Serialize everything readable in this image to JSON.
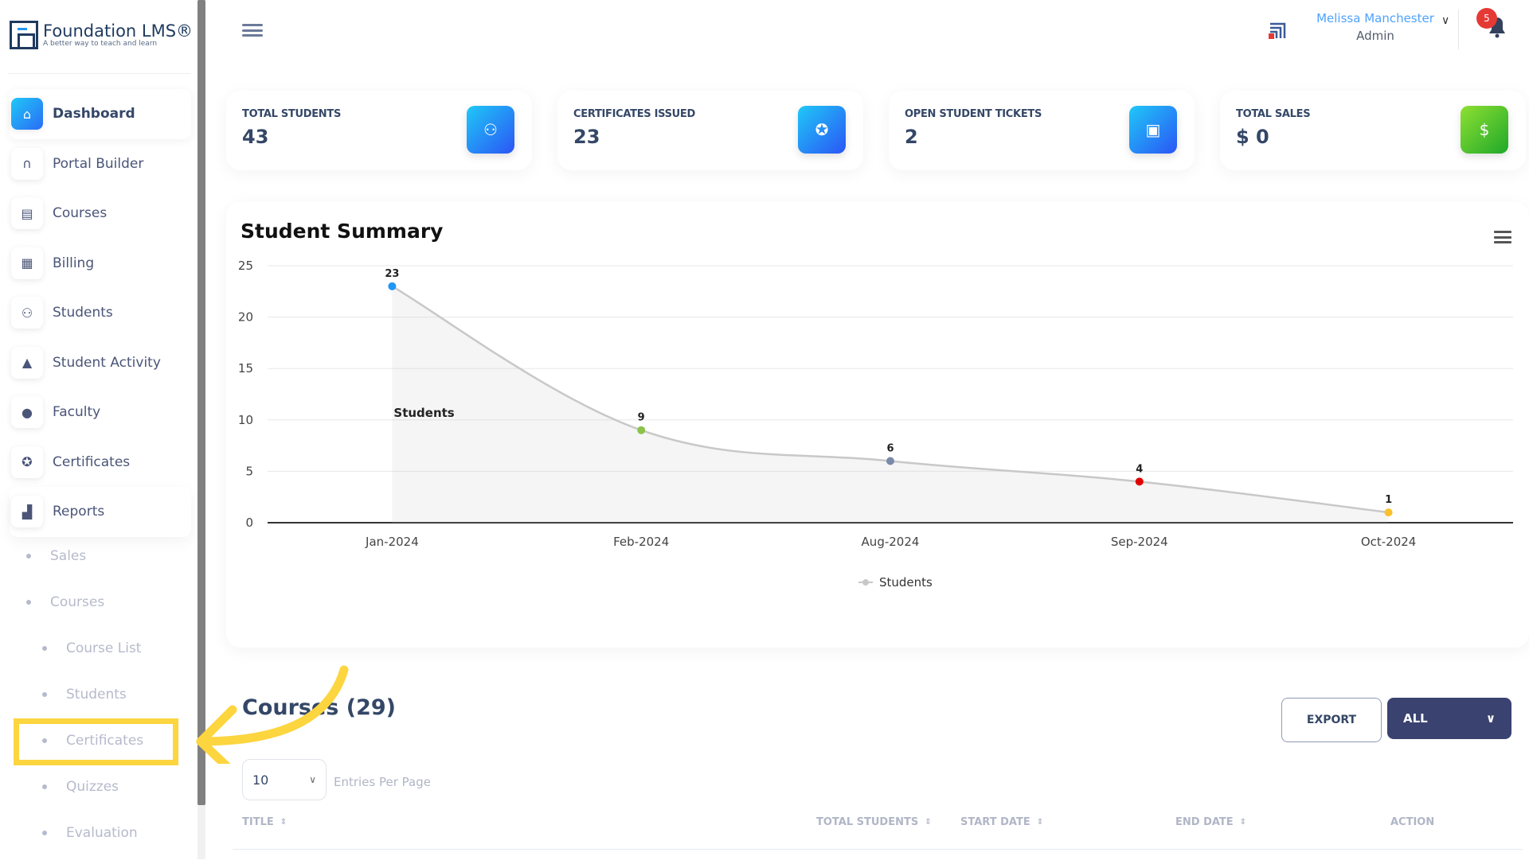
{
  "app": {
    "logo_title": "Foundation LMS®",
    "logo_subtitle": "A better way to teach and learn"
  },
  "sidebar": {
    "items": [
      {
        "label": "Dashboard",
        "icon": "home-icon",
        "active": true
      },
      {
        "label": "Portal Builder",
        "icon": "archway-icon"
      },
      {
        "label": "Courses",
        "icon": "book-icon"
      },
      {
        "label": "Billing",
        "icon": "document-icon"
      },
      {
        "label": "Students",
        "icon": "users-icon"
      },
      {
        "label": "Student Activity",
        "icon": "graduation-cap-icon"
      },
      {
        "label": "Faculty",
        "icon": "user-tie-icon"
      },
      {
        "label": "Certificates",
        "icon": "award-icon"
      },
      {
        "label": "Reports",
        "icon": "area-chart-icon"
      }
    ],
    "report_subitems": [
      {
        "label": "Sales",
        "level": 1
      },
      {
        "label": "Courses",
        "level": 1
      },
      {
        "label": "Course List",
        "level": 2
      },
      {
        "label": "Students",
        "level": 2
      },
      {
        "label": "Certificates",
        "level": 2,
        "highlighted": true
      },
      {
        "label": "Quizzes",
        "level": 2
      },
      {
        "label": "Evaluation",
        "level": 2
      }
    ]
  },
  "header": {
    "user_name": "Melissa Manchester",
    "user_role": "Admin",
    "notification_count": "5"
  },
  "stats": [
    {
      "label": "TOTAL STUDENTS",
      "value": "43",
      "icon": "users-icon"
    },
    {
      "label": "CERTIFICATES ISSUED",
      "value": "23",
      "icon": "award-icon"
    },
    {
      "label": "OPEN STUDENT TICKETS",
      "value": "2",
      "icon": "ticket-icon"
    },
    {
      "label": "TOTAL SALES",
      "value": "$ 0",
      "icon": "dollar-icon"
    }
  ],
  "chart_data": {
    "type": "area",
    "title": "Student Summary",
    "categories": [
      "Jan-2024",
      "Feb-2024",
      "Aug-2024",
      "Sep-2024",
      "Oct-2024"
    ],
    "series": [
      {
        "name": "Students",
        "values": [
          23,
          9,
          6,
          4,
          1
        ]
      }
    ],
    "point_colors": [
      "#2196f3",
      "#8bc34a",
      "#7a8aa8",
      "#e00000",
      "#fbc02d"
    ],
    "ylim": [
      0,
      25
    ],
    "yticks": [
      0,
      5,
      10,
      15,
      20,
      25
    ],
    "annotation": "Students",
    "legend": "bottom-center",
    "grid": true,
    "xlabel": "",
    "ylabel": ""
  },
  "courses": {
    "title": "Courses (29)",
    "export_label": "EXPORT",
    "filter_value": "ALL",
    "entries_value": "10",
    "entries_label": "Entries Per Page",
    "columns": [
      "TITLE",
      "TOTAL STUDENTS",
      "START DATE",
      "END DATE",
      "ACTION"
    ]
  }
}
